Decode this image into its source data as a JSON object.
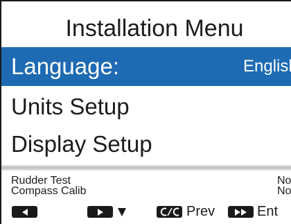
{
  "title": "Installation Menu",
  "menu": {
    "items": [
      {
        "label": "Language:",
        "value": "English"
      },
      {
        "label": "Units Setup"
      },
      {
        "label": "Display Setup"
      }
    ]
  },
  "status": {
    "items": [
      {
        "label": "Rudder Test",
        "value": "No"
      },
      {
        "label": "Compass Calib",
        "value": "No"
      }
    ]
  },
  "softkeys": {
    "prev_label": "Prev",
    "enter_label": "Ent"
  },
  "colors": {
    "selection": "#1e6bb3",
    "background": "#ffffff",
    "text": "#1c1c1c"
  },
  "icons": {
    "left_key": "left-arrow-icon",
    "right_key": "right-arrow-icon",
    "down": "down-arrow-icon",
    "clear_key": "clear-key-icon",
    "enter_key": "double-right-arrow-icon"
  }
}
